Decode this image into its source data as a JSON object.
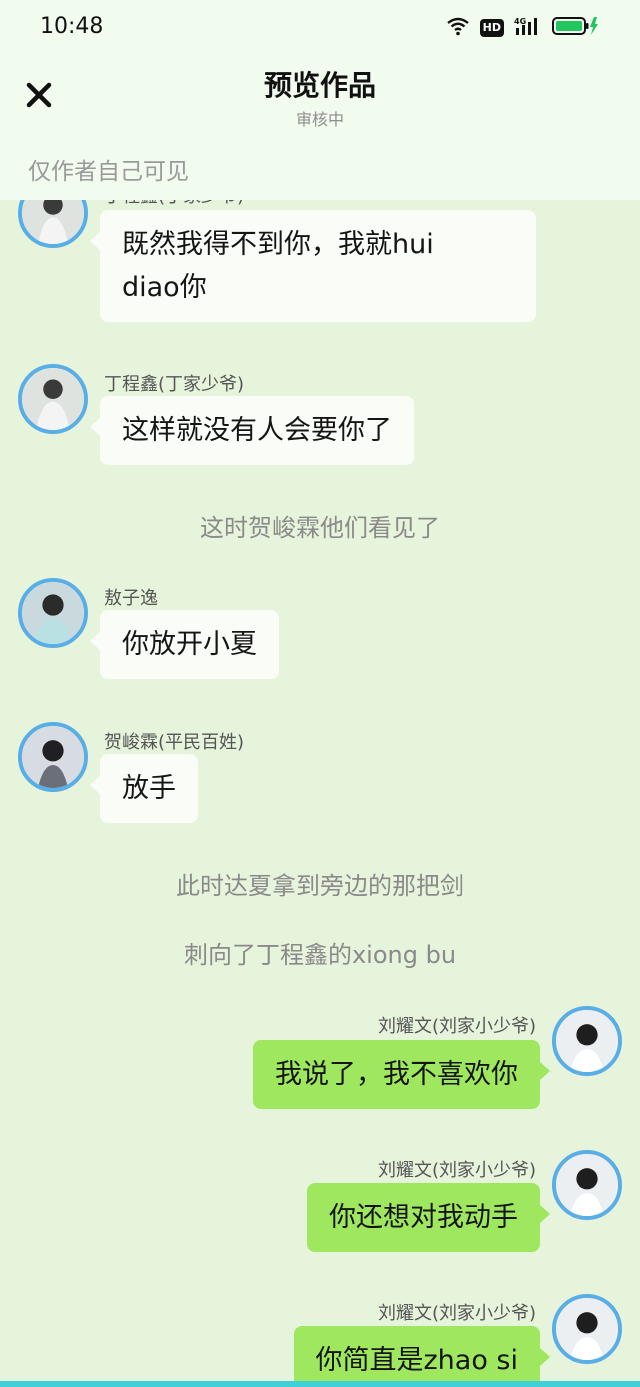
{
  "status_bar": {
    "time": "10:48",
    "network": "4G",
    "hd": "HD"
  },
  "nav": {
    "title": "预览作品",
    "subtitle": "审核中"
  },
  "visibility_note": "仅作者自己可见",
  "messages": [
    {
      "name": "丁程鑫(丁家少爷)",
      "text_line1": "既然我得不到你，我就hui",
      "text_line2": "diao你"
    },
    {
      "name": "丁程鑫(丁家少爷)",
      "text": "这样就没有人会要你了"
    },
    {
      "narration": "这时贺峻霖他们看见了"
    },
    {
      "name": "敖子逸",
      "text": "你放开小夏"
    },
    {
      "name": "贺峻霖(平民百姓)",
      "text": "放手"
    },
    {
      "narration": "此时达夏拿到旁边的那把剑"
    },
    {
      "narration": "刺向了丁程鑫的xiong bu"
    },
    {
      "name": "刘耀文(刘家小少爷)",
      "text": "我说了，我不喜欢你"
    },
    {
      "name": "刘耀文(刘家小少爷)",
      "text": "你还想对我动手"
    },
    {
      "name": "刘耀文(刘家小少爷)",
      "text": "你简直是zhao si"
    }
  ],
  "colors": {
    "left_bubble": "#fafdf7",
    "right_bubble": "#9ee75e",
    "avatar_ring": "#5aaee6",
    "background": "#e6f4dc"
  }
}
